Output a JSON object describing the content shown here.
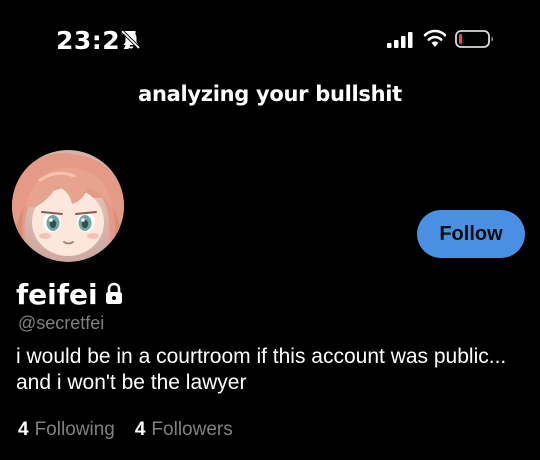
{
  "status_bar": {
    "time": "23:27",
    "icons": [
      "bell-off-icon",
      "signal-icon",
      "wifi-icon",
      "battery-icon"
    ],
    "battery_level_fraction": 0.12,
    "battery_color": "#e5484d"
  },
  "caption": "analyzing your bullshit",
  "profile": {
    "avatar": "avatar-image",
    "display_name": "feifei",
    "locked_icon": "lock-icon",
    "handle": "@secretfei",
    "bio": "i would be in a courtroom if this account was public... and i won't be the lawyer",
    "following_count": "4",
    "following_label": "Following",
    "followers_count": "4",
    "followers_label": "Followers"
  },
  "follow_button": {
    "label": "Follow",
    "color": "#4a90e2"
  }
}
